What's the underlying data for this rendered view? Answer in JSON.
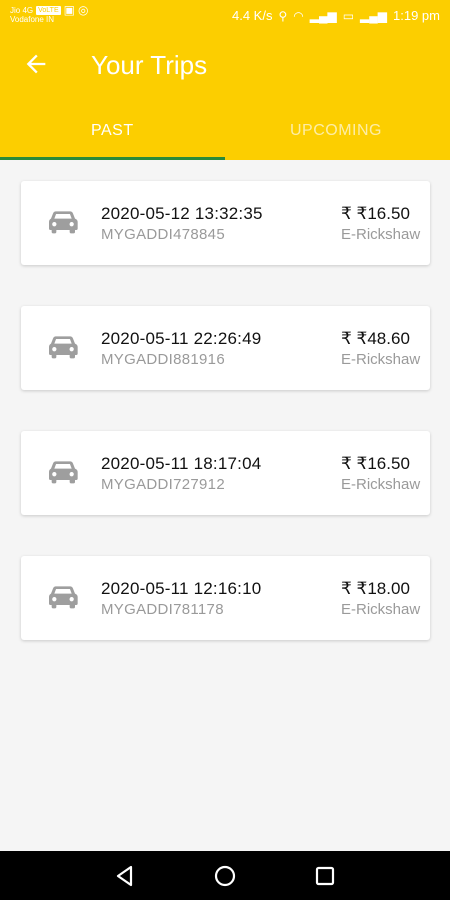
{
  "status_bar": {
    "carrier_line1": "Jio 4G",
    "carrier_badge": "VoLTE",
    "carrier_line2": "Vodafone IN",
    "speed": "4.4 K/s",
    "time": "1:19 pm"
  },
  "toolbar": {
    "title": "Your Trips"
  },
  "tabs": [
    {
      "label": "PAST"
    },
    {
      "label": "UPCOMING"
    }
  ],
  "trips": [
    {
      "datetime": "2020-05-12 13:32:35",
      "vehicle_id": "MYGADDI478845",
      "price": "₹ ₹16.50",
      "type": "E-Rickshaw"
    },
    {
      "datetime": "2020-05-11 22:26:49",
      "vehicle_id": "MYGADDI881916",
      "price": "₹ ₹48.60",
      "type": "E-Rickshaw"
    },
    {
      "datetime": "2020-05-11 18:17:04",
      "vehicle_id": "MYGADDI727912",
      "price": "₹ ₹16.50",
      "type": "E-Rickshaw"
    },
    {
      "datetime": "2020-05-11 12:16:10",
      "vehicle_id": "MYGADDI781178",
      "price": "₹ ₹18.00",
      "type": "E-Rickshaw"
    }
  ],
  "colors": {
    "accent": "#fcce00",
    "tab_indicator": "#2a8a3a",
    "background": "#f5f5f5"
  },
  "icons": {
    "back": "arrow-left-icon",
    "trip": "car-icon",
    "nav_back": "triangle-back-icon",
    "nav_home": "circle-home-icon",
    "nav_recents": "square-recents-icon"
  }
}
